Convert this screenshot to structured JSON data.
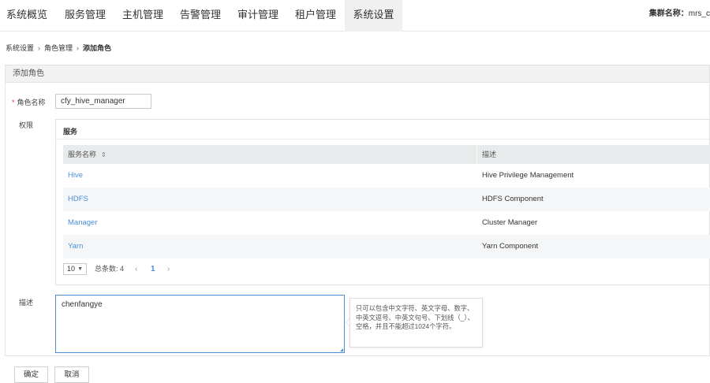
{
  "nav": {
    "tabs": [
      {
        "label": "系统概览"
      },
      {
        "label": "服务管理"
      },
      {
        "label": "主机管理"
      },
      {
        "label": "告警管理"
      },
      {
        "label": "审计管理"
      },
      {
        "label": "租户管理"
      },
      {
        "label": "系统设置",
        "active": true
      }
    ],
    "cluster_label": "集群名称：",
    "cluster_value": "mrs_c"
  },
  "breadcrumb": {
    "items": [
      "系统设置",
      "角色管理",
      "添加角色"
    ],
    "separator": "›"
  },
  "panel": {
    "title": "添加角色"
  },
  "form": {
    "role_name_label": "角色名称",
    "role_name_value": "cfy_hive_manager",
    "required_mark": "*",
    "permission_label": "权限",
    "description_label": "描述",
    "description_value": "chenfangye",
    "description_tip": "只可以包含中文字符、英文字母、数字、中英文逗号、中英文句号、下划线（_）、空格，并且不能超过1024个字符。"
  },
  "services": {
    "title": "服务",
    "columns": [
      "服务名称",
      "描述"
    ],
    "sort_icon": "⇕",
    "rows": [
      {
        "name": "Hive",
        "desc": "Hive Privilege Management"
      },
      {
        "name": "HDFS",
        "desc": "HDFS Component"
      },
      {
        "name": "Manager",
        "desc": "Cluster Manager"
      },
      {
        "name": "Yarn",
        "desc": "Yarn Component"
      }
    ],
    "pager": {
      "page_size": "10",
      "total_text": "总条数: 4",
      "prev": "‹",
      "page": "1",
      "next": "›"
    }
  },
  "buttons": {
    "confirm": "确定",
    "cancel": "取消"
  },
  "colors": {
    "link": "#4a90d9",
    "required": "#e4393c",
    "active_tab_bg": "#f0f0f0"
  }
}
